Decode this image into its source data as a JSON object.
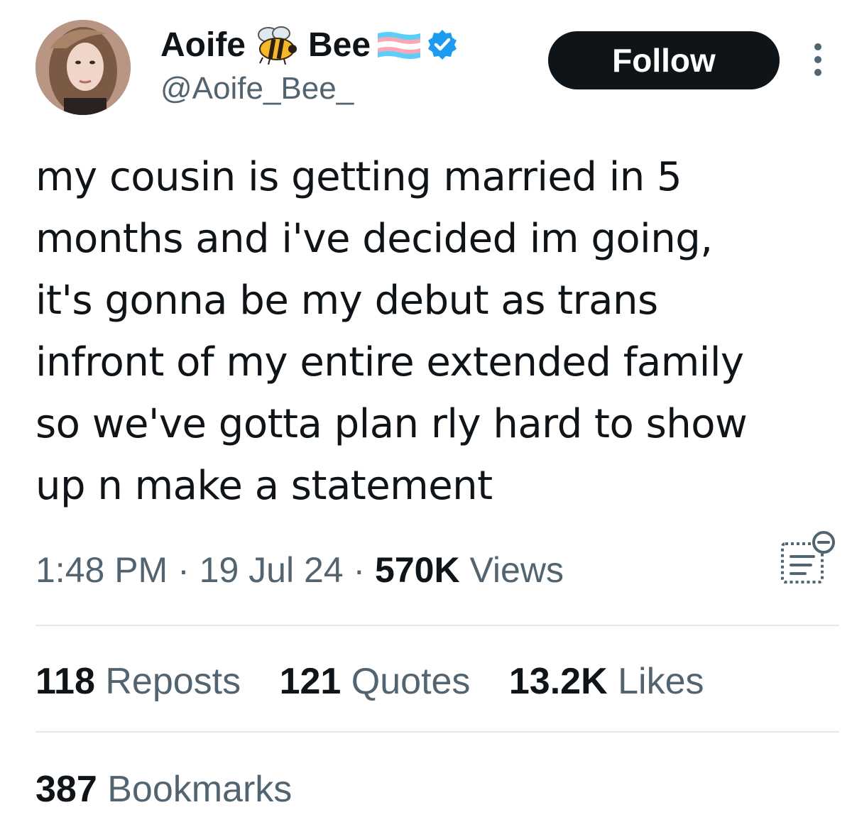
{
  "author": {
    "name_first": "Aoife",
    "name_second": "Bee",
    "handle": "@Aoife_Bee_",
    "name_icons": [
      "bee-icon",
      "transgender-flag-icon",
      "verified-badge-icon"
    ],
    "verified_color": "#1d9bf0"
  },
  "follow_button": {
    "label": "Follow"
  },
  "tweet": {
    "lines": [
      "my cousin is getting married in 5",
      "months and i've decided im going,",
      "it's gonna be my debut as trans",
      "infront of my entire extended family",
      "so we've gotta plan rly hard to show",
      "up n make a statement"
    ]
  },
  "meta": {
    "time": "1:48 PM",
    "separator": " · ",
    "date": "19 Jul 24",
    "views_count": "570K",
    "views_label": "Views"
  },
  "stats": {
    "reposts_count": "118",
    "reposts_label": "Reposts",
    "quotes_count": "121",
    "quotes_label": "Quotes",
    "likes_count": "13.2K",
    "likes_label": "Likes",
    "bookmarks_count": "387",
    "bookmarks_label": "Bookmarks"
  },
  "colors": {
    "text_primary": "#0f1419",
    "text_secondary": "#536471",
    "button_bg": "#0f1419",
    "button_text": "#ffffff",
    "divider": "#e1e8ed"
  }
}
